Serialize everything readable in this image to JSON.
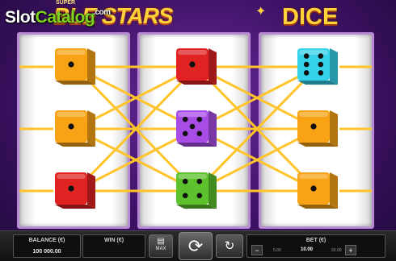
{
  "header": {
    "watermark_slot": "Slot",
    "watermark_catalog": "Catalog",
    "watermark_tld": ".com",
    "title_small": "SUPER",
    "title_main": "BLE STARS",
    "title_dice": "DICE"
  },
  "reels": [
    {
      "dice": [
        {
          "color": "orange",
          "pips": 1
        },
        {
          "color": "orange",
          "pips": 1
        },
        {
          "color": "red",
          "pips": 1
        }
      ]
    },
    {
      "dice": [
        {
          "color": "red",
          "pips": 1
        },
        {
          "color": "purple",
          "pips": 5
        },
        {
          "color": "green",
          "pips": 4
        }
      ]
    },
    {
      "dice": [
        {
          "color": "cyan",
          "pips": 6
        },
        {
          "color": "orange",
          "pips": 1
        },
        {
          "color": "orange",
          "pips": 1
        }
      ]
    }
  ],
  "colors": {
    "orange": "#f7a315",
    "red": "#e02222",
    "purple": "#a84ce6",
    "green": "#5cc12c",
    "cyan": "#35d2ea",
    "payline": "#ffc42a",
    "reel_border": "#b98bd4"
  },
  "controls": {
    "balance_label": "BALANCE (€)",
    "balance_value": "100 000.00",
    "win_label": "WIN (€)",
    "win_value": "",
    "max_label": "MAX",
    "max_icon": "coin-stack-icon",
    "spin_icon": "spin-arrows-icon",
    "auto_icon": "autoplay-icon",
    "bet_label": "BET (€)",
    "bet_minus": "−",
    "bet_plus": "+",
    "bet_options": [
      "5.00",
      "10.00",
      "20.00"
    ],
    "bet_selected": "10.00"
  }
}
